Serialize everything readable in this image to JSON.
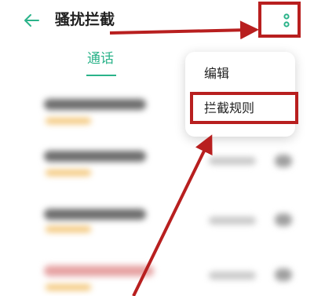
{
  "header": {
    "title": "骚扰拦截",
    "back_icon": "arrow-left-icon",
    "more_icon": "more-vertical-icon"
  },
  "tabs": [
    {
      "label": "通话",
      "selected": true
    }
  ],
  "menu": {
    "items": [
      {
        "label": "编辑"
      },
      {
        "label": "拦截规则"
      }
    ]
  },
  "colors": {
    "accent": "#2bb38a",
    "annotation": "#b81f1f"
  }
}
